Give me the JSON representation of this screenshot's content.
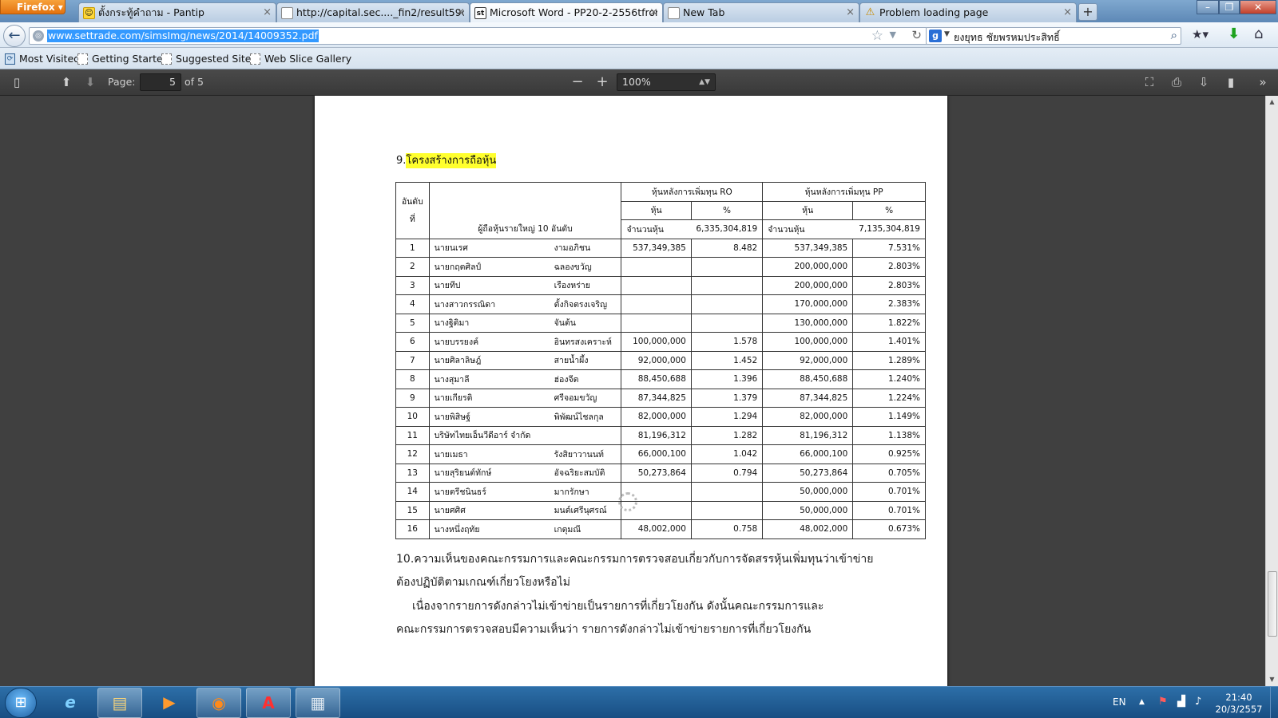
{
  "browser": {
    "menu_label": "Firefox",
    "tabs": [
      {
        "label": "ตั้งกระทู้คำถาม - Pantip",
        "icon": "emoji-icon",
        "glyph": "☺"
      },
      {
        "label": "http://capital.sec...._fin2/result59c.php",
        "icon": "page-icon",
        "glyph": ""
      },
      {
        "label": "Microsoft Word - PP20-2-2556tfromn...",
        "icon": "settrade-icon",
        "glyph": "st"
      },
      {
        "label": "New Tab",
        "icon": "page-icon",
        "glyph": ""
      },
      {
        "label": "Problem loading page",
        "icon": "warning-icon",
        "glyph": "⚠"
      }
    ],
    "active_tab": 2,
    "new_tab_glyph": "+",
    "window_controls": {
      "minimize": "–",
      "restore": "❐",
      "close": "✕"
    },
    "url": "www.settrade.com/simsImg/news/2014/14009352.pdf",
    "search_text": "ยงยุทธ  ชัยพรหมประสิทธิ์",
    "bookmarks": [
      "Most Visited",
      "Getting Started",
      "Suggested Sites",
      "Web Slice Gallery"
    ]
  },
  "pdf_toolbar": {
    "page_label": "Page:",
    "page_value": "5",
    "page_of": "of 5",
    "zoom": "100%",
    "icons": [
      "sidebar-toggle-icon",
      "previous-page-icon",
      "next-page-icon",
      "zoom-out-icon",
      "zoom-in-icon",
      "fullscreen-icon",
      "print-icon",
      "download-icon",
      "bookmark-icon",
      "tools-icon"
    ]
  },
  "document": {
    "heading9_num": "9.",
    "heading9_text": "โครงสร้างการถือหุ้น",
    "table": {
      "col_rank": "อันดับ\nที่",
      "col_name": "ผู้ถือหุ้นรายใหญ่ 10 อันดับ",
      "group_ro": "หุ้นหลังการเพิ่มทุน RO",
      "group_pp": "หุ้นหลังการเพิ่มทุน PP",
      "sub_shares": "หุ้น",
      "sub_pct": "%",
      "total_label": "จำนวนหุ้น",
      "total_ro": "6,335,304,819",
      "total_pp": "7,135,304,819",
      "rows": [
        {
          "rank": "1",
          "first": "นายนเรศ",
          "last": "งามอภิชน",
          "ro_shares": "537,349,385",
          "ro_pct": "8.482",
          "pp_shares": "537,349,385",
          "pp_pct": "7.531%"
        },
        {
          "rank": "2",
          "first": "นายกฤตศิลป์",
          "last": "ฉลองขวัญ",
          "ro_shares": "",
          "ro_pct": "",
          "pp_shares": "200,000,000",
          "pp_pct": "2.803%"
        },
        {
          "rank": "3",
          "first": "นายทีป",
          "last": "เรืองหร่าย",
          "ro_shares": "",
          "ro_pct": "",
          "pp_shares": "200,000,000",
          "pp_pct": "2.803%"
        },
        {
          "rank": "4",
          "first": "นางสาวกรรณิดา",
          "last": "ตั้งกิจตรงเจริญ",
          "ro_shares": "",
          "ro_pct": "",
          "pp_shares": "170,000,000",
          "pp_pct": "2.383%"
        },
        {
          "rank": "5",
          "first": "นางฐิติมา",
          "last": "จันต้น",
          "ro_shares": "",
          "ro_pct": "",
          "pp_shares": "130,000,000",
          "pp_pct": "1.822%"
        },
        {
          "rank": "6",
          "first": "นายบรรยงค์",
          "last": "อินทรสงเคราะห์",
          "ro_shares": "100,000,000",
          "ro_pct": "1.578",
          "pp_shares": "100,000,000",
          "pp_pct": "1.401%"
        },
        {
          "rank": "7",
          "first": "นายศิลาลิษฎ์",
          "last": "สายน้ำผึ้ง",
          "ro_shares": "92,000,000",
          "ro_pct": "1.452",
          "pp_shares": "92,000,000",
          "pp_pct": "1.289%"
        },
        {
          "rank": "8",
          "first": "นางสุมาลี",
          "last": "ฮ่องจีต",
          "ro_shares": "88,450,688",
          "ro_pct": "1.396",
          "pp_shares": "88,450,688",
          "pp_pct": "1.240%"
        },
        {
          "rank": "9",
          "first": "นายเกียรติ",
          "last": "ศรีจอมขวัญ",
          "ro_shares": "87,344,825",
          "ro_pct": "1.379",
          "pp_shares": "87,344,825",
          "pp_pct": "1.224%"
        },
        {
          "rank": "10",
          "first": "นายพิสิษฐ์",
          "last": "พิพัฒน์ไชลกุล",
          "ro_shares": "82,000,000",
          "ro_pct": "1.294",
          "pp_shares": "82,000,000",
          "pp_pct": "1.149%"
        },
        {
          "rank": "11",
          "first": "บริษัทไทยเอ็นวีดีอาร์ จำกัด",
          "last": "",
          "ro_shares": "81,196,312",
          "ro_pct": "1.282",
          "pp_shares": "81,196,312",
          "pp_pct": "1.138%"
        },
        {
          "rank": "12",
          "first": "นายเมธา",
          "last": "รังสิยาวานนท์",
          "ro_shares": "66,000,100",
          "ro_pct": "1.042",
          "pp_shares": "66,000,100",
          "pp_pct": "0.925%"
        },
        {
          "rank": "13",
          "first": "นายสุริยนต์ทักษ์",
          "last": "อัจฉริยะสมบัติ",
          "ro_shares": "50,273,864",
          "ro_pct": "0.794",
          "pp_shares": "50,273,864",
          "pp_pct": "0.705%"
        },
        {
          "rank": "14",
          "first": "นายตรีชนินธร์",
          "last": "มากรักษา",
          "ro_shares": "",
          "ro_pct": "",
          "pp_shares": "50,000,000",
          "pp_pct": "0.701%"
        },
        {
          "rank": "15",
          "first": "นายศศิศ",
          "last": "มนต์เศรีนุศรณ์",
          "ro_shares": "",
          "ro_pct": "",
          "pp_shares": "50,000,000",
          "pp_pct": "0.701%"
        },
        {
          "rank": "16",
          "first": "นางหนึ่งฤทัย",
          "last": "เกตุมณี",
          "ro_shares": "48,002,000",
          "ro_pct": "0.758",
          "pp_shares": "48,002,000",
          "pp_pct": "0.673%"
        }
      ]
    },
    "para_10_line1": "10.ความเห็นของคณะกรรมการและคณะกรรมการตรวจสอบเกี่ยวกับการจัดสรรหุ้นเพิ่มทุนว่าเข้าข่าย",
    "para_10_line2": "ต้องปฏิบัติตามเกณฑ์เกี่ยวโยงหรือไม่",
    "para_10_line3": "เนื่องจากรายการดังกล่าวไม่เข้าข่ายเป็นรายการที่เกี่ยวโยงกัน  ดังนั้นคณะกรรมการและ",
    "para_10_line4": "คณะกรรมการตรวจสอบมีความเห็นว่า รายการดังกล่าวไม่เข้าข่ายรายการที่เกี่ยวโยงกัน"
  },
  "taskbar": {
    "language": "EN",
    "time": "21:40",
    "date": "20/3/2557",
    "apps": [
      "internet-explorer-icon",
      "file-explorer-icon",
      "media-player-icon",
      "firefox-icon",
      "acrobat-icon",
      "calculator-icon"
    ]
  }
}
